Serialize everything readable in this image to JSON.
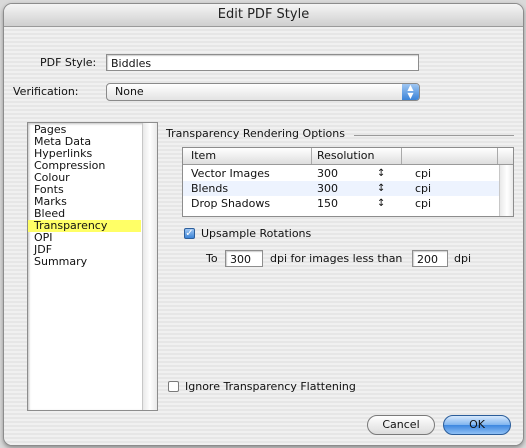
{
  "window": {
    "title": "Edit PDF Style"
  },
  "form": {
    "pdf_style_label": "PDF Style:",
    "pdf_style_value": "Biddles",
    "verification_label": "Verification:",
    "verification_value": "None"
  },
  "sidebar": {
    "items": [
      "Pages",
      "Meta Data",
      "Hyperlinks",
      "Compression",
      "Colour",
      "Fonts",
      "Marks",
      "Bleed",
      "Transparency",
      "OPI",
      "JDF",
      "Summary"
    ],
    "selected": "Transparency",
    "selected_color": "#ffff66"
  },
  "transparency": {
    "group_label": "Transparency Rendering Options",
    "table": {
      "columns": [
        "Item",
        "Resolution"
      ],
      "rows": [
        {
          "item": "Vector Images",
          "resolution": "300",
          "unit": "cpi"
        },
        {
          "item": "Blends",
          "resolution": "300",
          "unit": "cpi"
        },
        {
          "item": "Drop Shadows",
          "resolution": "150",
          "unit": "cpi"
        }
      ]
    },
    "upsample": {
      "label": "Upsample Rotations",
      "checked": true,
      "to_label": "To",
      "to_value": "300",
      "middle_label": "dpi for images less than",
      "threshold_value": "200",
      "unit_label": "dpi"
    },
    "ignore_flattening": {
      "label": "Ignore Transparency Flattening",
      "checked": false
    }
  },
  "buttons": {
    "cancel": "Cancel",
    "ok": "OK"
  },
  "colors": {
    "accent": "#3b84d8",
    "selection": "#ffff66"
  }
}
